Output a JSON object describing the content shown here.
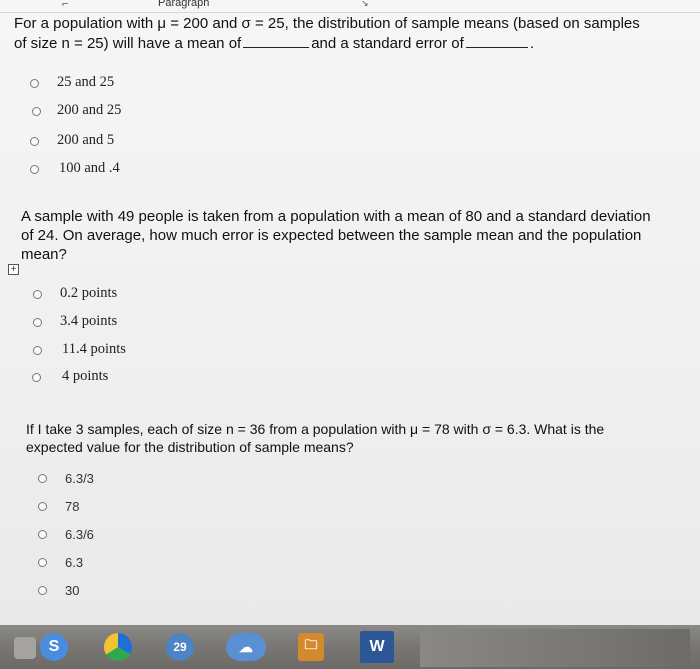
{
  "toolbar": {
    "style_label": "Paragraph",
    "corner_glyph": "⌐",
    "expand_glyph": "↘"
  },
  "questions": [
    {
      "line1": "For a population with μ = 200 and σ = 25, the distribution of sample means (based on samples",
      "line2_a": "of size n = 25) will have a mean of",
      "line2_b": "and a standard error of",
      "line2_c": ".",
      "options": [
        "25 and 25",
        "200 and 25",
        "200 and 5",
        "100 and .4"
      ]
    },
    {
      "line1": "A sample with 49 people is taken from a population with a mean of 80 and a standard deviation",
      "line2": "of 24. On average, how much error is expected between the sample mean and the population",
      "line3": "mean?",
      "expand_glyph": "+",
      "options": [
        "0.2 points",
        "3.4 points",
        "11.4 points",
        "4 points"
      ]
    },
    {
      "line1": "If I take 3 samples, each of size n = 36 from a population with μ = 78 with σ = 6.3. What is the",
      "line2": "expected value for the distribution of sample means?",
      "options": [
        "6.3/3",
        "78",
        "6.3/6",
        "6.3",
        "30"
      ]
    }
  ],
  "taskbar": {
    "skype_glyph": "S",
    "calendar_glyph": "29",
    "cloud_glyph": "☁",
    "folder_glyph": "🗀",
    "word_glyph": "W"
  },
  "colors": {
    "page_bg": "#f1f1f1",
    "taskbar": "#7a7874",
    "word": "#2b5797",
    "skype": "#4a8de0"
  }
}
